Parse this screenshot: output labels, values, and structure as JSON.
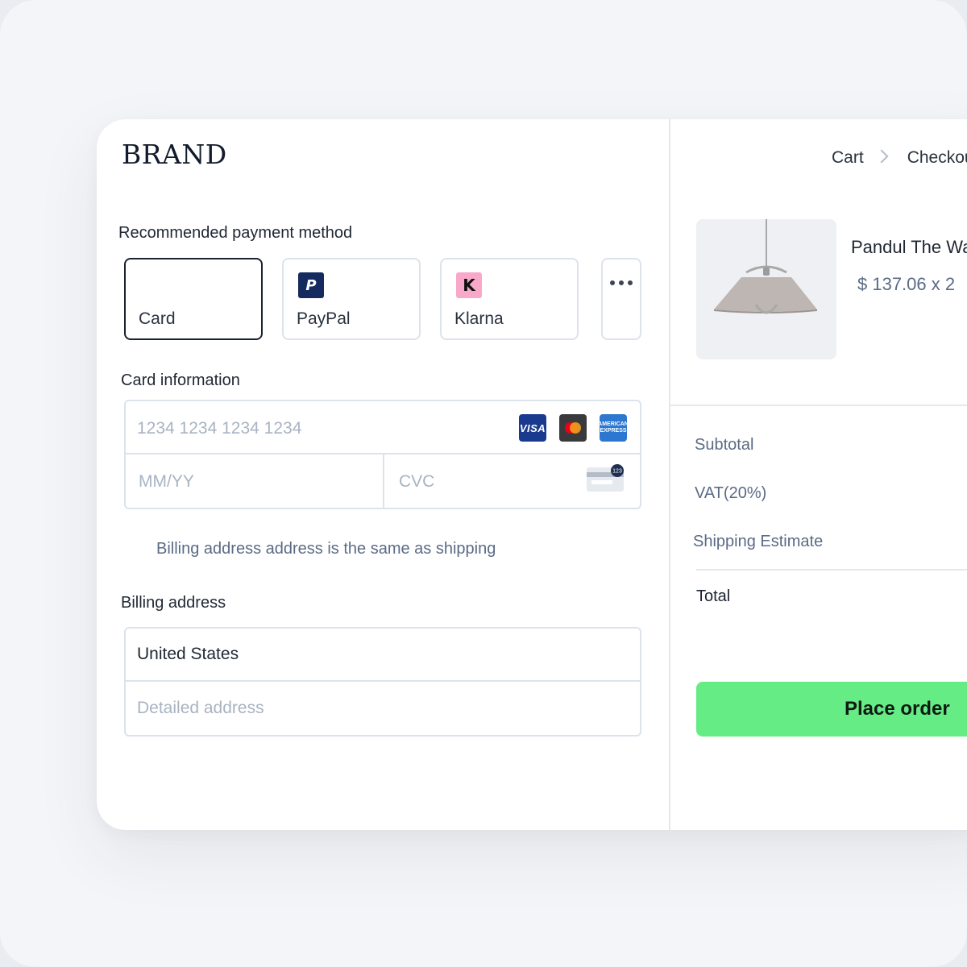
{
  "brand": {
    "logo": "BRAND"
  },
  "payment": {
    "label": "Recommended payment method",
    "methods": [
      {
        "name": "Card",
        "selected": true
      },
      {
        "name": "PayPal",
        "logo_letter": "P",
        "logo_color": "#152a5e"
      },
      {
        "name": "Klarna",
        "logo_letter": "K",
        "logo_color": "#f8a9c9"
      }
    ],
    "more_icon": "more-horizontal-icon"
  },
  "card_info": {
    "label": "Card information",
    "number_placeholder": "1234 1234 1234 1234",
    "expiry_placeholder": "MM/YY",
    "cvc_placeholder": "CVC",
    "cvc_badge": "123",
    "brand_icons": [
      "VISA",
      "mastercard",
      "AMERICAN EXPRESS"
    ]
  },
  "billing_same": "Billing address address is the same as shipping",
  "billing": {
    "label": "Billing address",
    "country": "United States",
    "address_placeholder": "Detailed address"
  },
  "breadcrumb": {
    "items": [
      "Cart",
      "Checkout"
    ]
  },
  "product": {
    "name": "Pandul The Wall Lamp",
    "price": "$ 137.06 x 2"
  },
  "summary": {
    "subtotal_label": "Subtotal",
    "vat_label": "VAT(20%)",
    "shipping_label": "Shipping Estimate",
    "total_label": "Total"
  },
  "place_order": "Place order",
  "colors": {
    "accent_button": "#66ec84",
    "text_primary": "#1f2733",
    "text_muted": "#5b6b85",
    "border": "#dde3ea"
  }
}
